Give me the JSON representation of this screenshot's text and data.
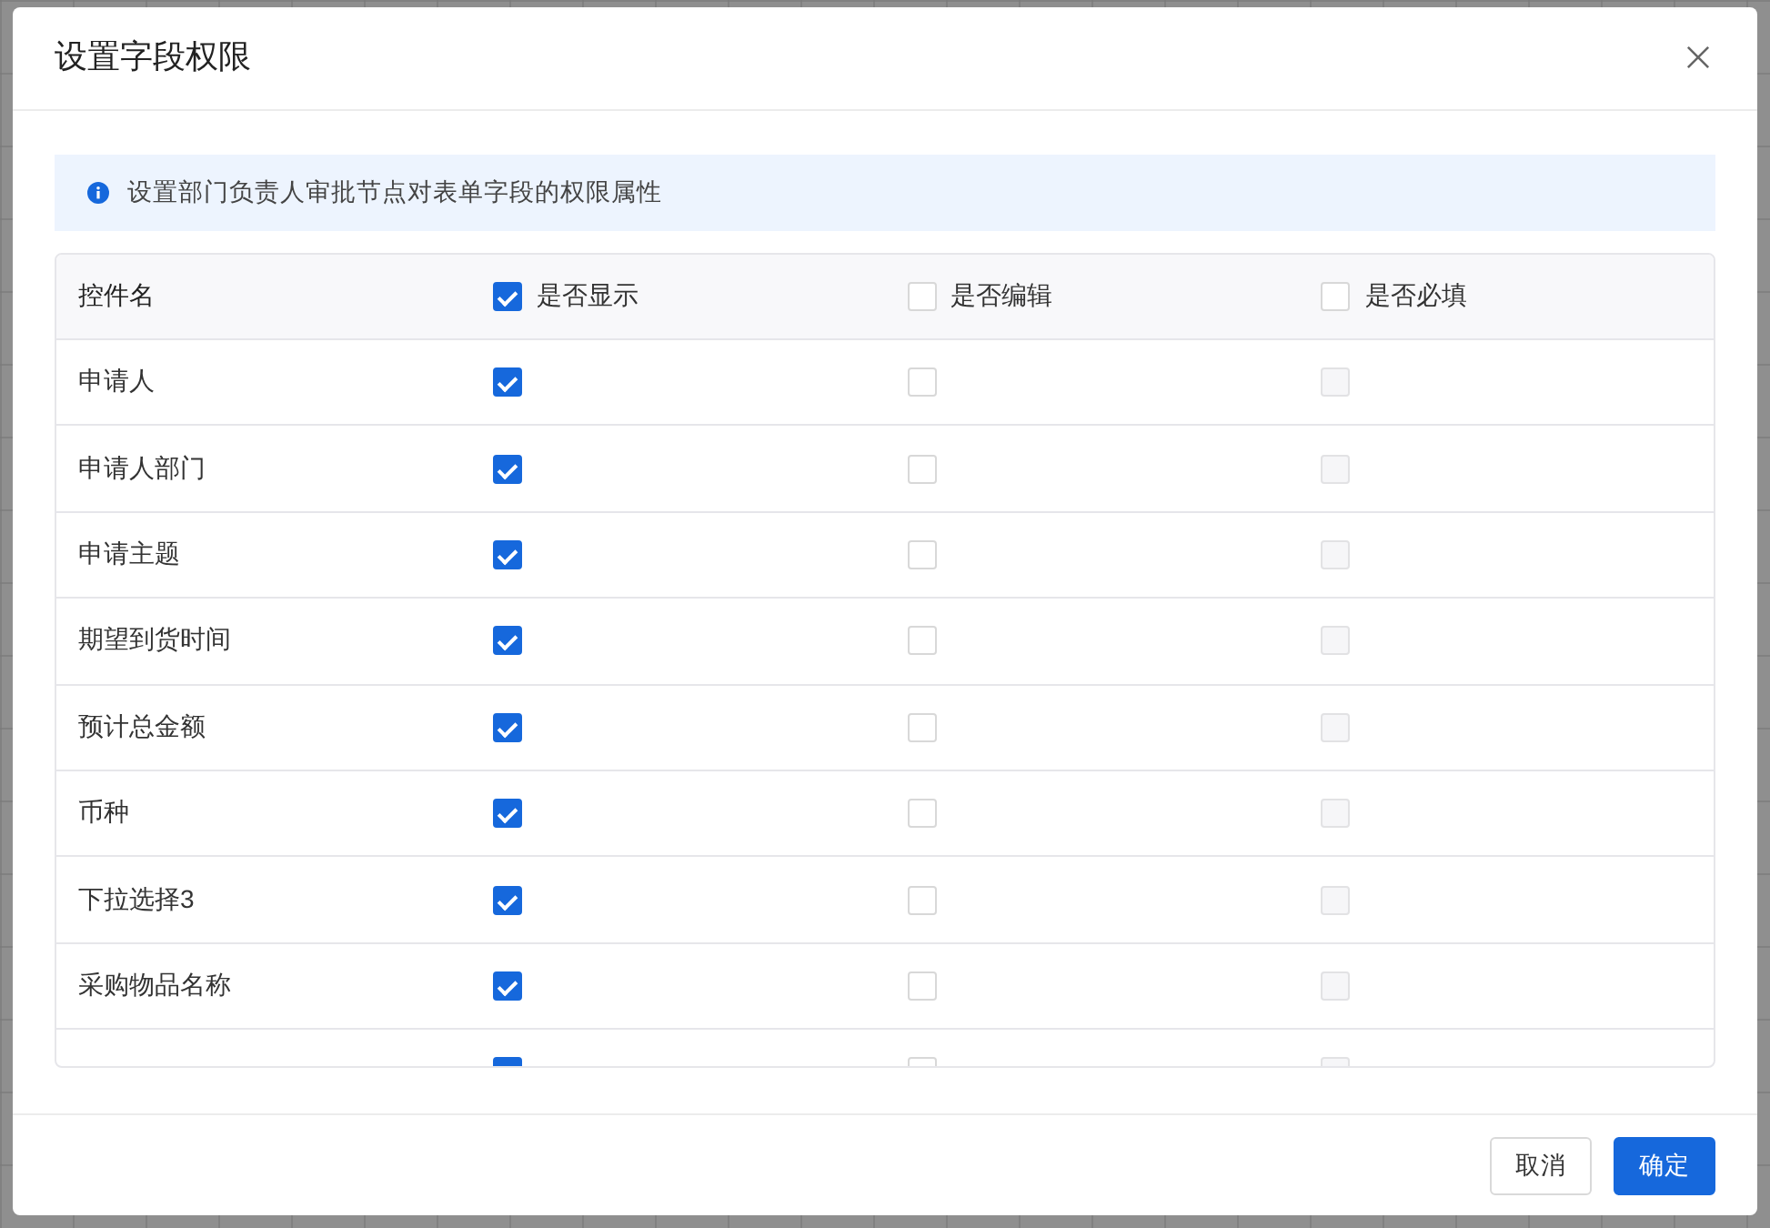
{
  "dialog": {
    "title": "设置字段权限"
  },
  "alert": {
    "text": "设置部门负责人审批节点对表单字段的权限属性"
  },
  "table": {
    "name_column": "控件名",
    "permission_columns": [
      {
        "label": "是否显示",
        "checked": true
      },
      {
        "label": "是否编辑",
        "checked": false
      },
      {
        "label": "是否必填",
        "checked": false
      }
    ],
    "rows": [
      {
        "name": "申请人",
        "cells": [
          {
            "checked": true,
            "disabled": false
          },
          {
            "checked": false,
            "disabled": false
          },
          {
            "checked": false,
            "disabled": true
          }
        ]
      },
      {
        "name": "申请人部门",
        "cells": [
          {
            "checked": true,
            "disabled": false
          },
          {
            "checked": false,
            "disabled": false
          },
          {
            "checked": false,
            "disabled": true
          }
        ]
      },
      {
        "name": "申请主题",
        "cells": [
          {
            "checked": true,
            "disabled": false
          },
          {
            "checked": false,
            "disabled": false
          },
          {
            "checked": false,
            "disabled": true
          }
        ]
      },
      {
        "name": "期望到货时间",
        "cells": [
          {
            "checked": true,
            "disabled": false
          },
          {
            "checked": false,
            "disabled": false
          },
          {
            "checked": false,
            "disabled": true
          }
        ]
      },
      {
        "name": "预计总金额",
        "cells": [
          {
            "checked": true,
            "disabled": false
          },
          {
            "checked": false,
            "disabled": false
          },
          {
            "checked": false,
            "disabled": true
          }
        ]
      },
      {
        "name": "币种",
        "cells": [
          {
            "checked": true,
            "disabled": false
          },
          {
            "checked": false,
            "disabled": false
          },
          {
            "checked": false,
            "disabled": true
          }
        ]
      },
      {
        "name": "下拉选择3",
        "cells": [
          {
            "checked": true,
            "disabled": false
          },
          {
            "checked": false,
            "disabled": false
          },
          {
            "checked": false,
            "disabled": true
          }
        ]
      },
      {
        "name": "采购物品名称",
        "cells": [
          {
            "checked": true,
            "disabled": false
          },
          {
            "checked": false,
            "disabled": false
          },
          {
            "checked": false,
            "disabled": true
          }
        ]
      },
      {
        "cells": [
          {
            "checked": true,
            "disabled": false
          },
          {
            "checked": false,
            "disabled": false
          },
          {
            "checked": false,
            "disabled": true
          }
        ]
      }
    ]
  },
  "buttons": [
    {
      "label": "取消",
      "kind": "default"
    },
    {
      "label": "确定",
      "kind": "primary"
    }
  ]
}
